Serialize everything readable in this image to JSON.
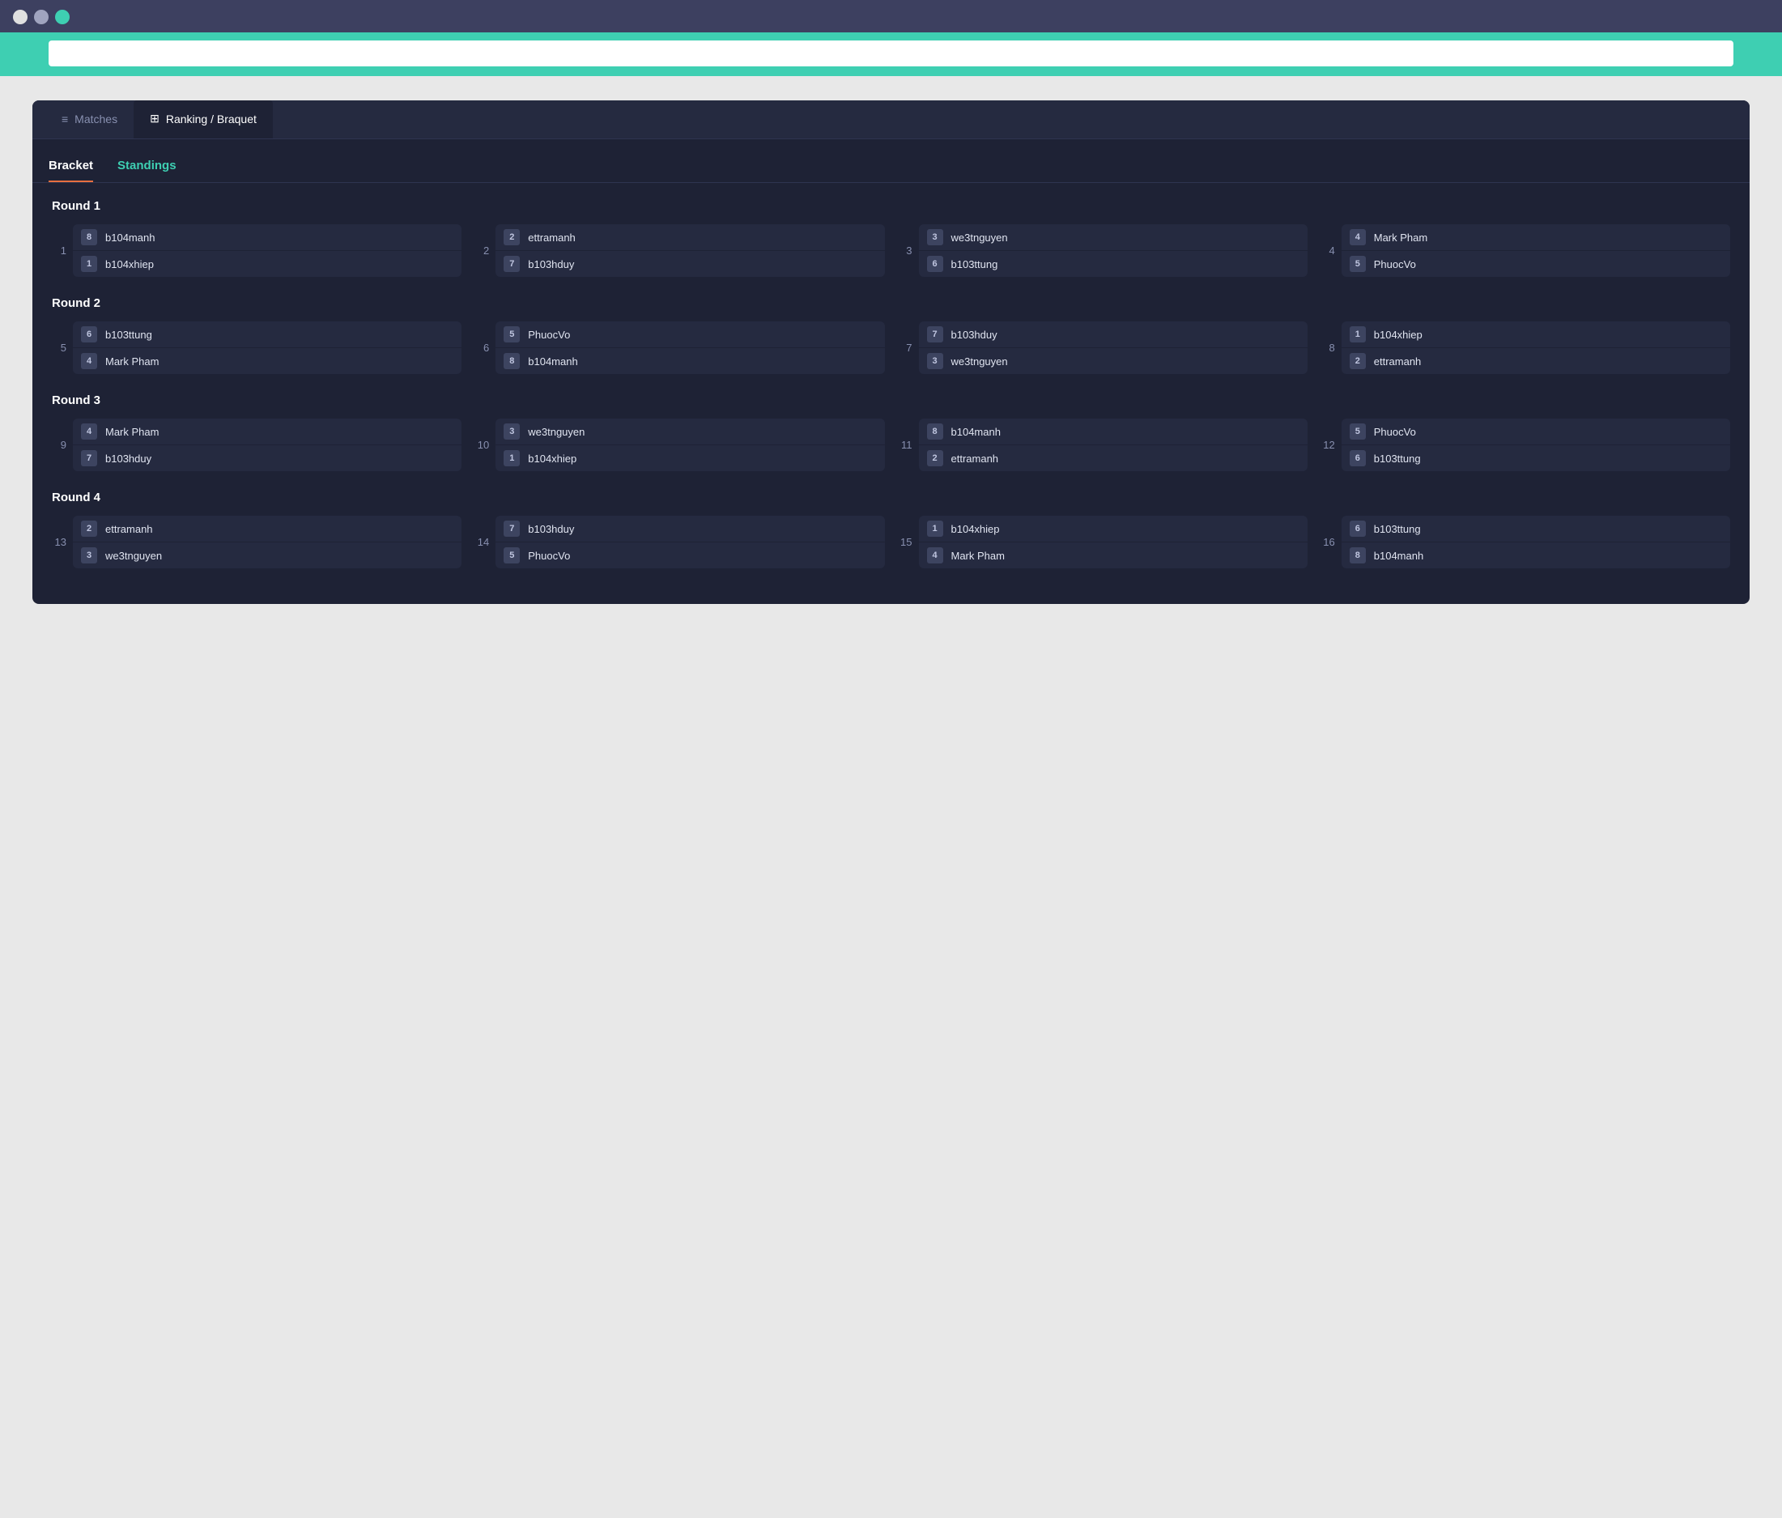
{
  "browser": {
    "dots": [
      "red",
      "yellow",
      "green"
    ]
  },
  "tabs": [
    {
      "id": "matches",
      "label": "Matches",
      "icon": "≡",
      "active": false
    },
    {
      "id": "ranking",
      "label": "Ranking / Braquet",
      "icon": "⊞",
      "active": true
    }
  ],
  "inner_tabs": [
    {
      "id": "bracket",
      "label": "Bracket",
      "active": true
    },
    {
      "id": "standings",
      "label": "Standings",
      "active": false
    }
  ],
  "rounds": [
    {
      "title": "Round 1",
      "matches": [
        {
          "num": 1,
          "p1": {
            "seed": 8,
            "name": "b104manh"
          },
          "p2": {
            "seed": 1,
            "name": "b104xhiep"
          }
        },
        {
          "num": 2,
          "p1": {
            "seed": 2,
            "name": "ettramanh"
          },
          "p2": {
            "seed": 7,
            "name": "b103hduy"
          }
        },
        {
          "num": 3,
          "p1": {
            "seed": 3,
            "name": "we3tnguyen"
          },
          "p2": {
            "seed": 6,
            "name": "b103ttung"
          }
        },
        {
          "num": 4,
          "p1": {
            "seed": 4,
            "name": "Mark Pham"
          },
          "p2": {
            "seed": 5,
            "name": "PhuocVo"
          }
        }
      ]
    },
    {
      "title": "Round 2",
      "matches": [
        {
          "num": 5,
          "p1": {
            "seed": 6,
            "name": "b103ttung"
          },
          "p2": {
            "seed": 4,
            "name": "Mark Pham"
          }
        },
        {
          "num": 6,
          "p1": {
            "seed": 5,
            "name": "PhuocVo"
          },
          "p2": {
            "seed": 8,
            "name": "b104manh"
          }
        },
        {
          "num": 7,
          "p1": {
            "seed": 7,
            "name": "b103hduy"
          },
          "p2": {
            "seed": 3,
            "name": "we3tnguyen"
          }
        },
        {
          "num": 8,
          "p1": {
            "seed": 1,
            "name": "b104xhiep"
          },
          "p2": {
            "seed": 2,
            "name": "ettramanh"
          }
        }
      ]
    },
    {
      "title": "Round 3",
      "matches": [
        {
          "num": 9,
          "p1": {
            "seed": 4,
            "name": "Mark Pham"
          },
          "p2": {
            "seed": 7,
            "name": "b103hduy"
          }
        },
        {
          "num": 10,
          "p1": {
            "seed": 3,
            "name": "we3tnguyen"
          },
          "p2": {
            "seed": 1,
            "name": "b104xhiep"
          }
        },
        {
          "num": 11,
          "p1": {
            "seed": 8,
            "name": "b104manh"
          },
          "p2": {
            "seed": 2,
            "name": "ettramanh"
          }
        },
        {
          "num": 12,
          "p1": {
            "seed": 5,
            "name": "PhuocVo"
          },
          "p2": {
            "seed": 6,
            "name": "b103ttung"
          }
        }
      ]
    },
    {
      "title": "Round 4",
      "matches": [
        {
          "num": 13,
          "p1": {
            "seed": 2,
            "name": "ettramanh"
          },
          "p2": {
            "seed": 3,
            "name": "we3tnguyen"
          }
        },
        {
          "num": 14,
          "p1": {
            "seed": 7,
            "name": "b103hduy"
          },
          "p2": {
            "seed": 5,
            "name": "PhuocVo"
          }
        },
        {
          "num": 15,
          "p1": {
            "seed": 1,
            "name": "b104xhiep"
          },
          "p2": {
            "seed": 4,
            "name": "Mark Pham"
          }
        },
        {
          "num": 16,
          "p1": {
            "seed": 6,
            "name": "b103ttung"
          },
          "p2": {
            "seed": 8,
            "name": "b104manh"
          }
        }
      ]
    }
  ]
}
